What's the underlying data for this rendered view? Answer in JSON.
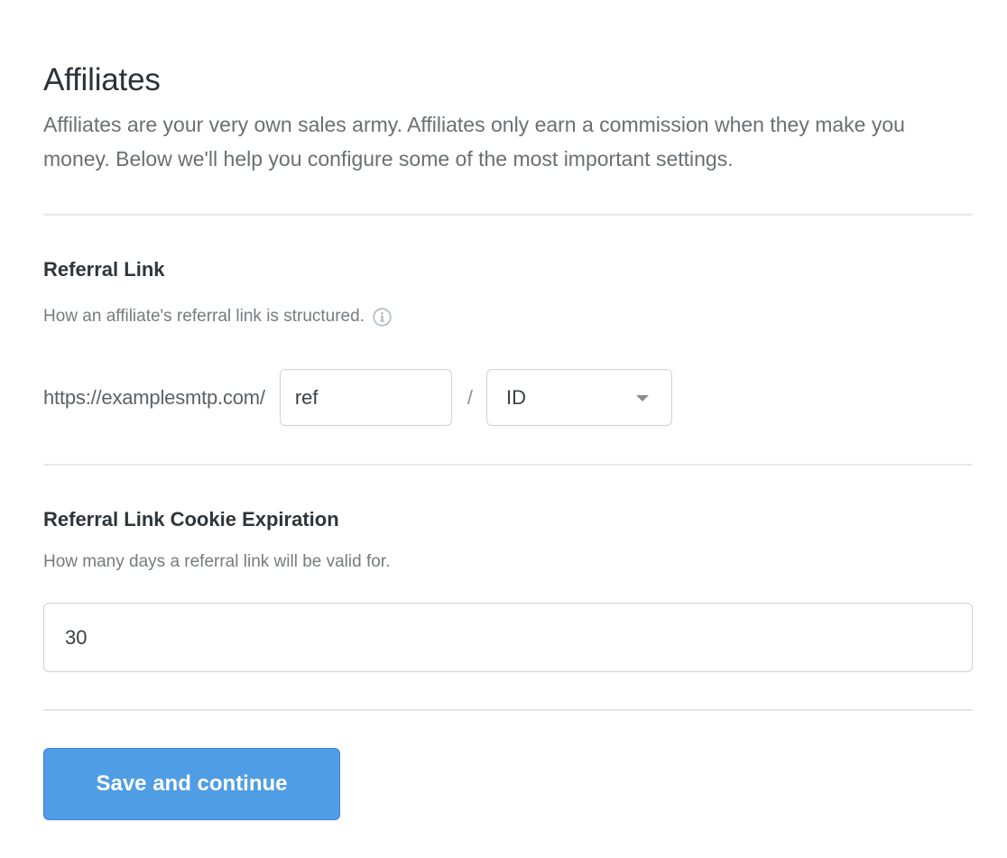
{
  "header": {
    "title": "Affiliates",
    "description": "Affiliates are your very own sales army. Affiliates only earn a commission when they make you money. Below we'll help you configure some of the most important settings."
  },
  "referral_link": {
    "title": "Referral Link",
    "help": "How an affiliate's referral link is structured.",
    "help_icon": "info-icon",
    "url_prefix": "https://examplesmtp.com/",
    "variable_value": "ref",
    "separator": "/",
    "format_select": {
      "selected": "ID",
      "icon": "chevron-down-icon"
    }
  },
  "cookie_expiration": {
    "title": "Referral Link Cookie Expiration",
    "help": "How many days a referral link will be valid for.",
    "value": "30"
  },
  "actions": {
    "save_label": "Save and continue"
  },
  "colors": {
    "accent": "#4f9de4",
    "accent_border": "#3f86cf",
    "divider": "#e7e8e9",
    "input_border": "#cfd3d6"
  }
}
